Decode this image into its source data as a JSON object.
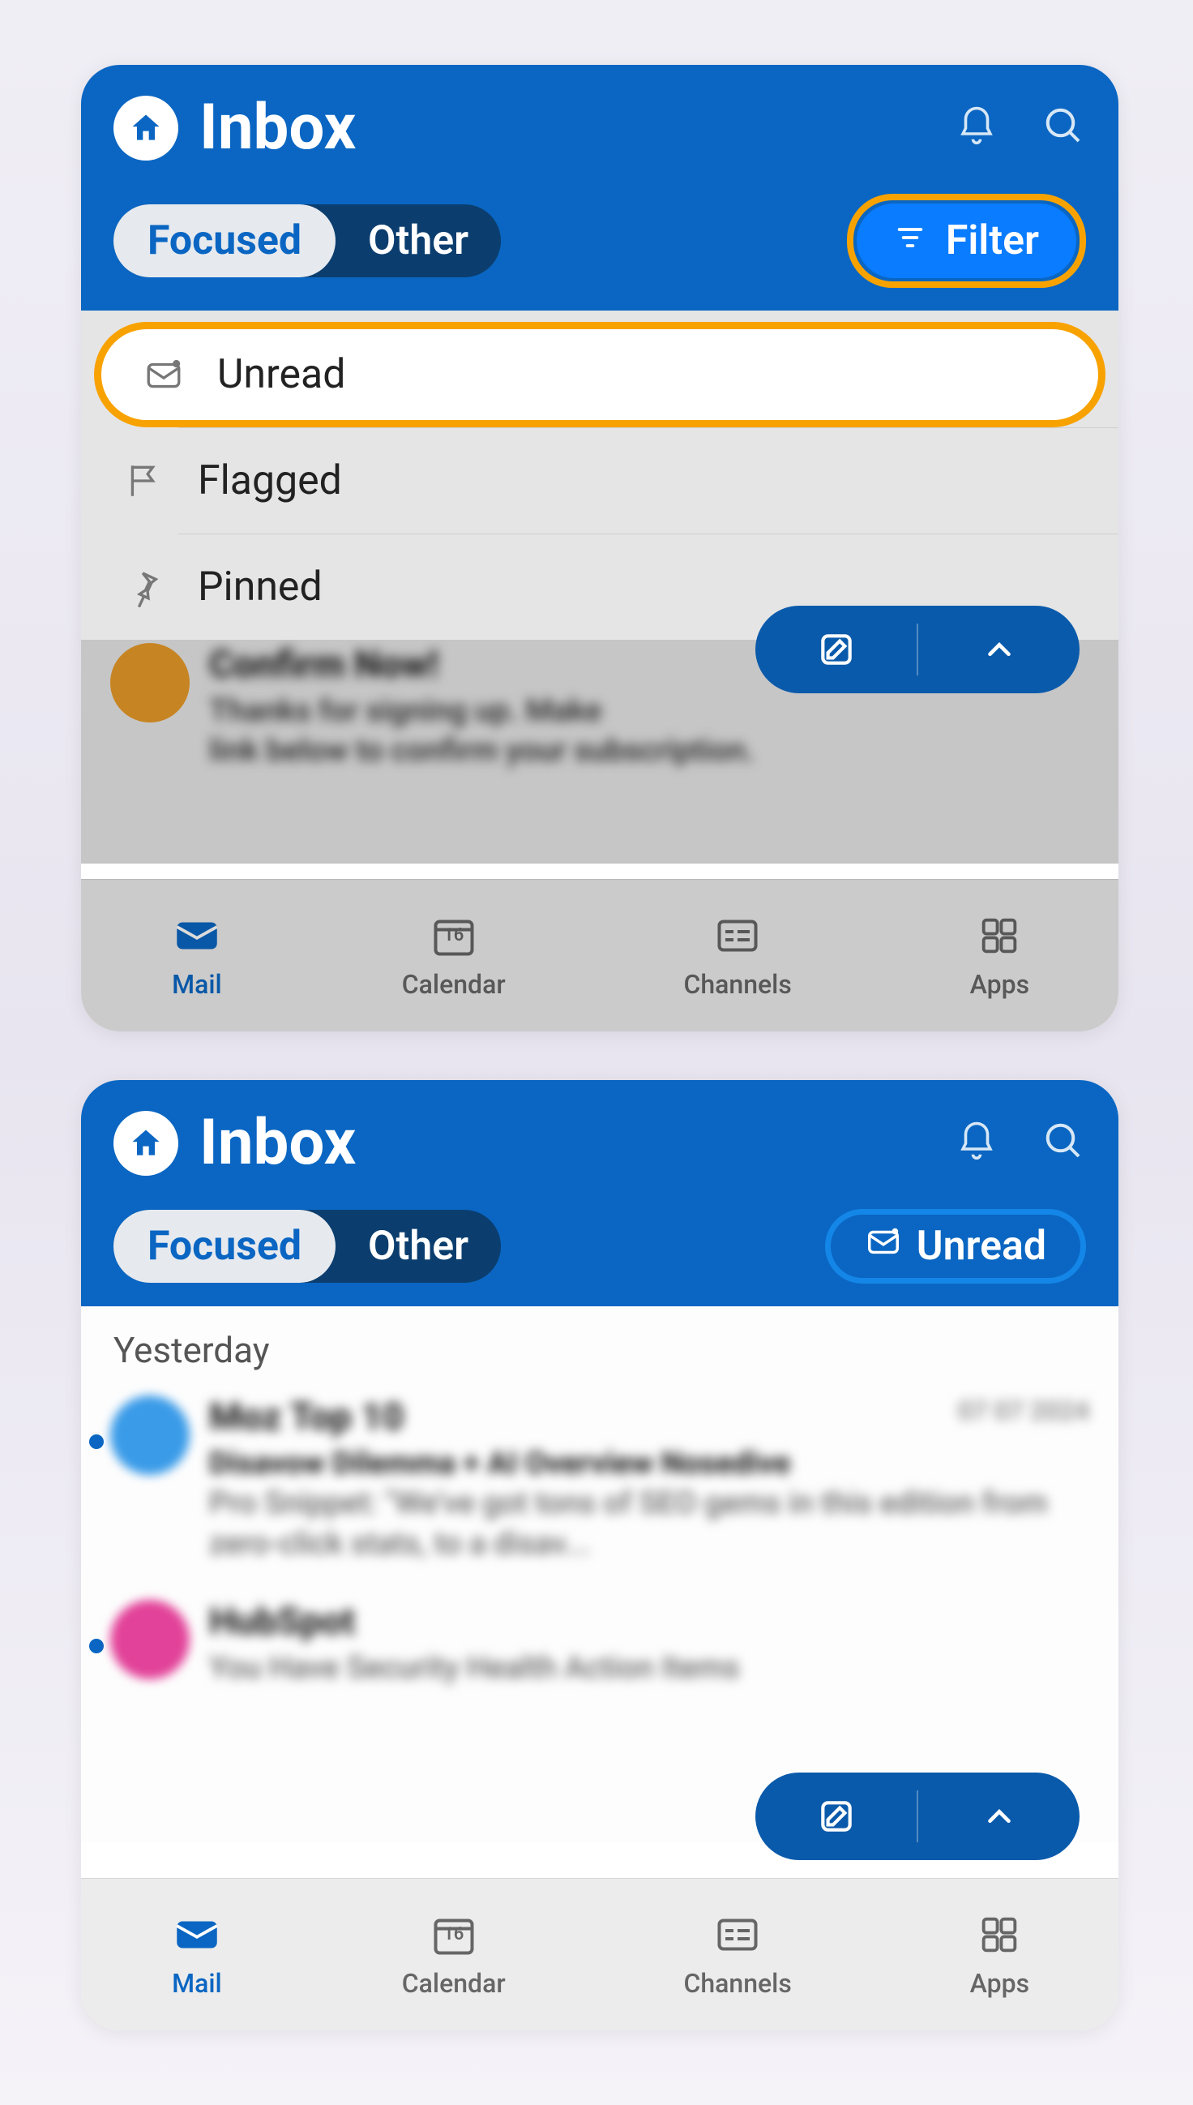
{
  "screenshot1": {
    "header": {
      "title": "Inbox"
    },
    "segmented": {
      "focused": "Focused",
      "other": "Other"
    },
    "filter_button": {
      "label": "Filter"
    },
    "dropdown": {
      "unread": "Unread",
      "flagged": "Flagged",
      "pinned": "Pinned"
    },
    "dimmed_email": {
      "subject": "Confirm Now!",
      "line1": "Thanks for signing up. Make",
      "line2": "link below to confirm your subscription."
    },
    "bottom_nav": {
      "mail": "Mail",
      "calendar": "Calendar",
      "calendar_day": "16",
      "channels": "Channels",
      "apps": "Apps"
    }
  },
  "screenshot2": {
    "header": {
      "title": "Inbox"
    },
    "segmented": {
      "focused": "Focused",
      "other": "Other"
    },
    "unread_pill": {
      "label": "Unread"
    },
    "section_label": "Yesterday",
    "emails": [
      {
        "sender": "Moz Top 10",
        "date": "07 07 2024",
        "subject": "Disavow Dilemma + AI Overview Nosedive",
        "preview": "Pro Snippet: \"We've got tons of SEO gems in this edition from zero-click stats, to a disav..."
      },
      {
        "sender": "HubSpot",
        "subject": "You Have Security Health Action Items"
      }
    ],
    "bottom_nav": {
      "mail": "Mail",
      "calendar": "Calendar",
      "calendar_day": "16",
      "channels": "Channels",
      "apps": "Apps"
    }
  }
}
